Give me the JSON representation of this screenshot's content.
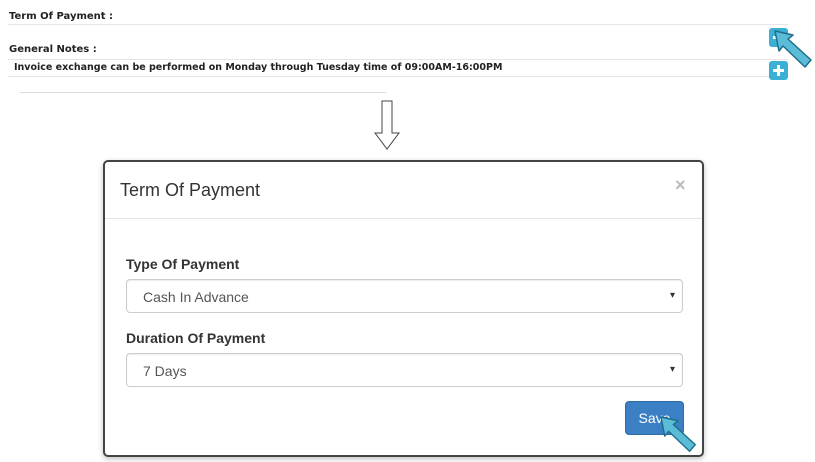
{
  "form": {
    "term_label": "Term Of Payment :",
    "notes_label": "General Notes :",
    "notes_text": "Invoice exchange can be performed on Monday through Tuesday time of 09:00AM-16:00PM"
  },
  "icons": {
    "add": "plus-icon",
    "pointer": "hand-pointer-icon",
    "arrow": "arrow-down-icon",
    "close": "close-icon",
    "caret": "caret-down-icon"
  },
  "modal": {
    "title": "Term Of Payment",
    "close_symbol": "×",
    "type_label": "Type Of Payment",
    "type_value": "Cash In Advance",
    "duration_label": "Duration Of Payment",
    "duration_value": "7 Days",
    "caret_symbol": "▾",
    "save_label": "Save"
  },
  "colors": {
    "add_button": "#3bb0d4",
    "save_button": "#3b7fc4",
    "pointer": "#5bbcd8"
  }
}
